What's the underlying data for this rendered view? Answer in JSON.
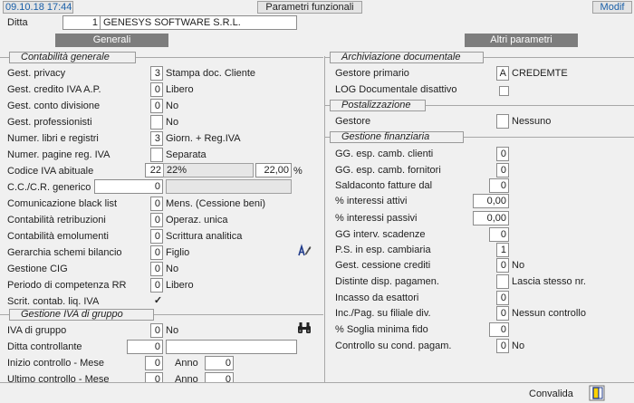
{
  "header": {
    "datetime": "09.10.18 17:44",
    "title": "Parametri funzionali",
    "mode": "Modif"
  },
  "ditta": {
    "label": "Ditta",
    "code": "1",
    "name": "GENESYS SOFTWARE S.R.L."
  },
  "tabs": {
    "generali": "Generali",
    "altri": "Altri parametri"
  },
  "contabilita": {
    "title": "Contabilità generale",
    "privacy": {
      "label": "Gest. privacy",
      "value": "3",
      "desc": "Stampa doc. Cliente"
    },
    "credito_iva": {
      "label": "Gest. credito IVA A.P.",
      "value": "0",
      "desc": "Libero"
    },
    "conto_divisione": {
      "label": "Gest. conto divisione",
      "value": "0",
      "desc": "No"
    },
    "professionisti": {
      "label": "Gest. professionisti",
      "value": "",
      "desc": "No"
    },
    "libri_registri": {
      "label": "Numer. libri e registri",
      "value": "3",
      "desc": "Giorn. + Reg.IVA"
    },
    "pagine_iva": {
      "label": "Numer. pagine reg. IVA",
      "value": "",
      "desc": "Separata"
    },
    "codice_iva": {
      "label": "Codice IVA abituale",
      "value": "22",
      "desc": "22%",
      "rate": "22,00",
      "unit": "%"
    },
    "ccr_generico": {
      "label": "C.C./C.R. generico",
      "value": "0",
      "desc": ""
    },
    "black_list": {
      "label": "Comunicazione black list",
      "value": "0",
      "desc": "Mens. (Cessione beni)"
    },
    "retribuzioni": {
      "label": "Contabilità retribuzioni",
      "value": "0",
      "desc": "Operaz. unica"
    },
    "emolumenti": {
      "label": "Contabilità emolumenti",
      "value": "0",
      "desc": "Scrittura analitica"
    },
    "gerarchia": {
      "label": "Gerarchia schemi bilancio",
      "value": "0",
      "desc": "Figlio"
    },
    "cig": {
      "label": "Gestione CIG",
      "value": "0",
      "desc": "No"
    },
    "competenza_rr": {
      "label": "Periodo di competenza RR",
      "value": "0",
      "desc": "Libero"
    },
    "scrit_liq_iva": {
      "label": "Scrit. contab. liq. IVA",
      "checked": "✓"
    }
  },
  "iva_gruppo": {
    "title": "Gestione IVA di gruppo",
    "iva_di_gruppo": {
      "label": "IVA di gruppo",
      "value": "0",
      "desc": "No"
    },
    "ditta_controllante": {
      "label": "Ditta controllante",
      "value": "0",
      "desc": ""
    },
    "inizio": {
      "label": "Inizio controllo - Mese",
      "mese": "0",
      "anno_label": "Anno",
      "anno": "0"
    },
    "ultimo": {
      "label": "Ultimo controllo - Mese",
      "mese": "0",
      "anno_label": "Anno",
      "anno": "0"
    }
  },
  "archiviazione": {
    "title": "Archiviazione documentale",
    "gestore_primario": {
      "label": "Gestore primario",
      "value": "A",
      "desc": "CREDEMTE"
    },
    "log": {
      "label": "LOG Documentale disattivo",
      "checked": ""
    }
  },
  "postalizzazione": {
    "title": "Postalizzazione",
    "gestore": {
      "label": "Gestore",
      "value": "",
      "desc": "Nessuno"
    }
  },
  "finanziaria": {
    "title": "Gestione finanziaria",
    "esp_clienti": {
      "label": "GG. esp. camb. clienti",
      "value": "0"
    },
    "esp_fornitori": {
      "label": "GG. esp. camb. fornitori",
      "value": "0"
    },
    "saldaconto": {
      "label": "Saldaconto fatture dal",
      "value": "0"
    },
    "int_attivi": {
      "label": "% interessi attivi",
      "value": "0,00"
    },
    "int_passivi": {
      "label": "% interessi passivi",
      "value": "0,00"
    },
    "gg_scadenze": {
      "label": "GG  interv.  scadenze",
      "value": "0"
    },
    "ps_cambiaria": {
      "label": "P.S. in esp. cambiaria",
      "value": "1"
    },
    "cessione_crediti": {
      "label": "Gest. cessione crediti",
      "value": "0",
      "desc": "No"
    },
    "distinte": {
      "label": "Distinte disp. pagamen.",
      "value": "",
      "desc": "Lascia stesso nr."
    },
    "incasso": {
      "label": "Incasso da esattori",
      "value": "0"
    },
    "inc_filiale": {
      "label": "Inc./Pag. su filiale div.",
      "value": "0",
      "desc": "Nessun controllo"
    },
    "soglia_fido": {
      "label": "% Soglia minima fido",
      "value": "0"
    },
    "cond_pagam": {
      "label": "Controllo su cond. pagam.",
      "value": "0",
      "desc": "No"
    }
  },
  "footer": {
    "convalida": "Convalida"
  },
  "icons": {
    "edit": "pencil-edit-icon",
    "search": "binoculars-icon",
    "confirm": "confirm-icon"
  },
  "colors": {
    "background": "#f0f0f0",
    "header_box": "#e4e4e4",
    "tab_dark": "#7d7d7d",
    "tab_text": "#ffffff",
    "datetime_text": "#1a5fa8",
    "mode_text": "#1a5fa8"
  }
}
